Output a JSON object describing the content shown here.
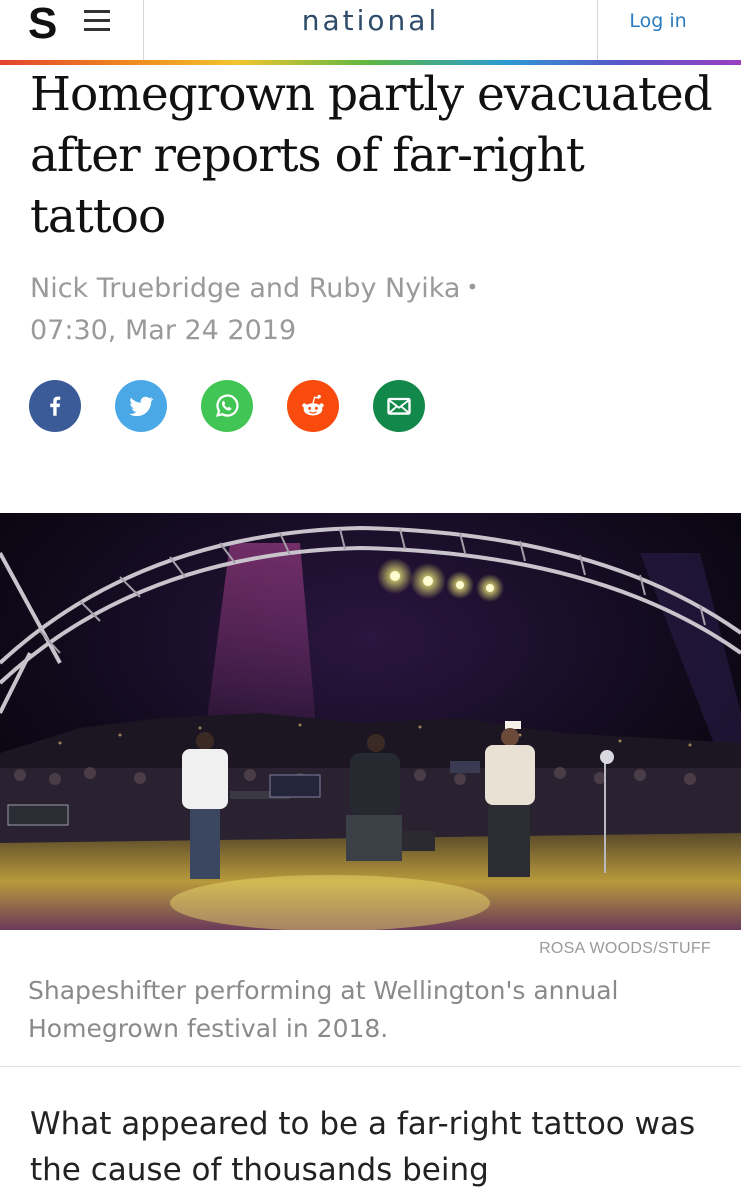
{
  "header": {
    "logo": "S",
    "section": "national",
    "login_label": "Log in"
  },
  "article": {
    "headline": "Homegrown partly evacuated after reports of far-right tattoo",
    "authors": "Nick Truebridge and Ruby Nyika",
    "separator": "•",
    "timestamp": "07:30, Mar 24 2019",
    "share_buttons": [
      {
        "icon": "facebook-icon",
        "color": "#3b5a98"
      },
      {
        "icon": "twitter-icon",
        "color": "#4aa8e6"
      },
      {
        "icon": "whatsapp-icon",
        "color": "#41c554"
      },
      {
        "icon": "reddit-icon",
        "color": "#fa4b0f"
      },
      {
        "icon": "email-icon",
        "color": "#12894a"
      }
    ],
    "photo_credit": "ROSA WOODS/STUFF",
    "photo_caption": "Shapeshifter performing at Wellington's annual Homegrown festival in 2018.",
    "body_start": "What appeared to be a far-right tattoo was the cause of thousands being"
  },
  "colors": {
    "section_text": "#2f4d6a",
    "link": "#2a7bbf",
    "meta_text": "#9a9a9a"
  }
}
